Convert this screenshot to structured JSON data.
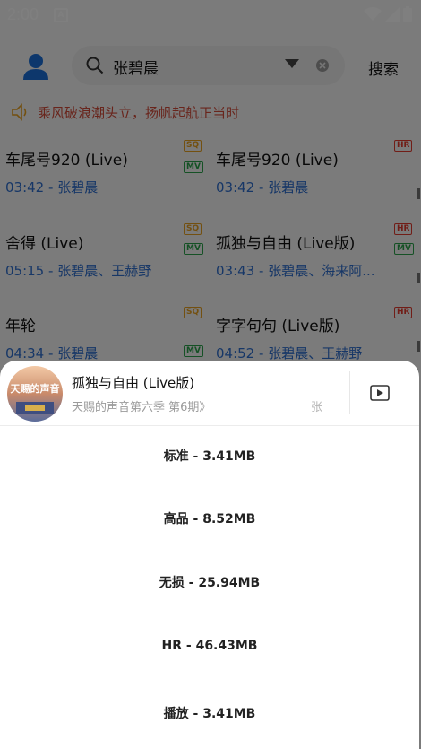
{
  "status": {
    "time": "2:00",
    "notification_glyph": "A"
  },
  "search": {
    "query": "张碧晨",
    "button_label": "搜索"
  },
  "notice": {
    "text": "乘风破浪潮头立，扬帆起航正当时"
  },
  "songs": [
    {
      "title": "车尾号920 (Live)",
      "duration": "03:42",
      "artists": "张碧晨",
      "badges": [
        "SQ",
        "MV"
      ]
    },
    {
      "title": "车尾号920 (Live)",
      "duration": "03:42",
      "artists": "张碧晨",
      "badges": [
        "HR"
      ]
    },
    {
      "title": "舍得 (Live)",
      "duration": "05:15",
      "artists": "张碧晨、王赫野",
      "badges": [
        "SQ",
        "MV"
      ]
    },
    {
      "title": "孤独与自由 (Live版)",
      "duration": "03:43",
      "artists": "张碧晨、海来阿...",
      "badges": [
        "HR",
        "MV"
      ]
    },
    {
      "title": "年轮",
      "duration": "04:34",
      "artists": "张碧晨",
      "badges": [
        "SQ",
        "MV"
      ]
    },
    {
      "title": "字字句句 (Live版)",
      "duration": "04:52",
      "artists": "张碧晨、王赫野",
      "badges": [
        "HR"
      ]
    }
  ],
  "sheet": {
    "title": "孤独与自由 (Live版)",
    "subtitle": "天赐的声音第六季 第6期》",
    "artist_fragment": "张",
    "cover_text": "天赐的声音",
    "options": [
      "标准 - 3.41MB",
      "高品 - 8.52MB",
      "无损 - 25.94MB",
      "HR - 46.43MB",
      "播放 - 3.41MB"
    ]
  },
  "colors": {
    "accent_blue": "#2f6fcf",
    "notice_red": "#d24a39",
    "sq": "#e7a021",
    "mv": "#2aa34a",
    "hr": "#e23b2e"
  }
}
